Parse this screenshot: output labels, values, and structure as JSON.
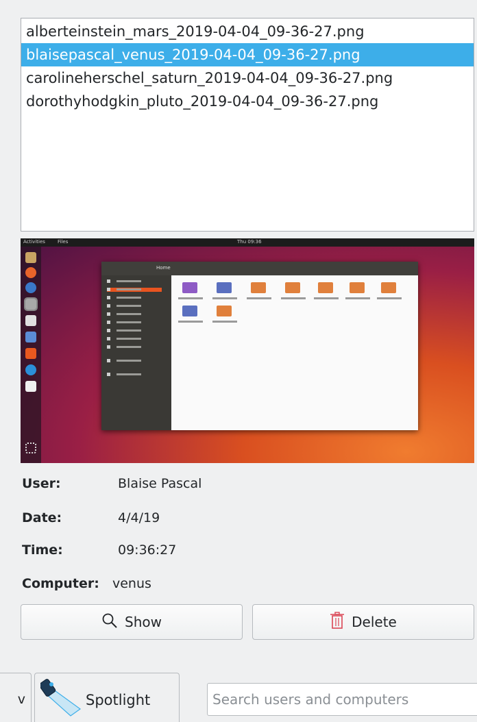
{
  "files": [
    {
      "name": "alberteinstein_mars_2019-04-04_09-36-27.png",
      "selected": false
    },
    {
      "name": "blaisepascal_venus_2019-04-04_09-36-27.png",
      "selected": true
    },
    {
      "name": "carolineherschel_saturn_2019-04-04_09-36-27.png",
      "selected": false
    },
    {
      "name": "dorothyhodgkin_pluto_2019-04-04_09-36-27.png",
      "selected": false
    }
  ],
  "preview": {
    "topbar_left": "Activities",
    "topbar_app": "Files",
    "topbar_clock": "Thu 09:36",
    "window_title": "Home",
    "sidebar_items": [
      "Recent",
      "Home",
      "Desktop",
      "Documents",
      "Downloads",
      "Music",
      "Pictures",
      "Videos",
      "Trash",
      "Ubuntu",
      "Other Locations"
    ],
    "folders": [
      "Desktop",
      "Documents",
      "Downloads",
      "Music",
      "Pictures",
      "Public",
      "Templates",
      "Videos",
      "Examples"
    ]
  },
  "details": {
    "user_label": "User:",
    "user_value": "Blaise Pascal",
    "date_label": "Date:",
    "date_value": "4/4/19",
    "time_label": "Time:",
    "time_value": "09:36:27",
    "computer_label": "Computer:",
    "computer_value": "venus"
  },
  "buttons": {
    "show": "Show",
    "delete": "Delete"
  },
  "bottom": {
    "partial_tab_text": "v",
    "spotlight": "Spotlight",
    "search_placeholder": "Search users and computers"
  },
  "colors": {
    "selection": "#3daee9",
    "delete_icon": "#da4453",
    "accent": "#3daee9"
  }
}
